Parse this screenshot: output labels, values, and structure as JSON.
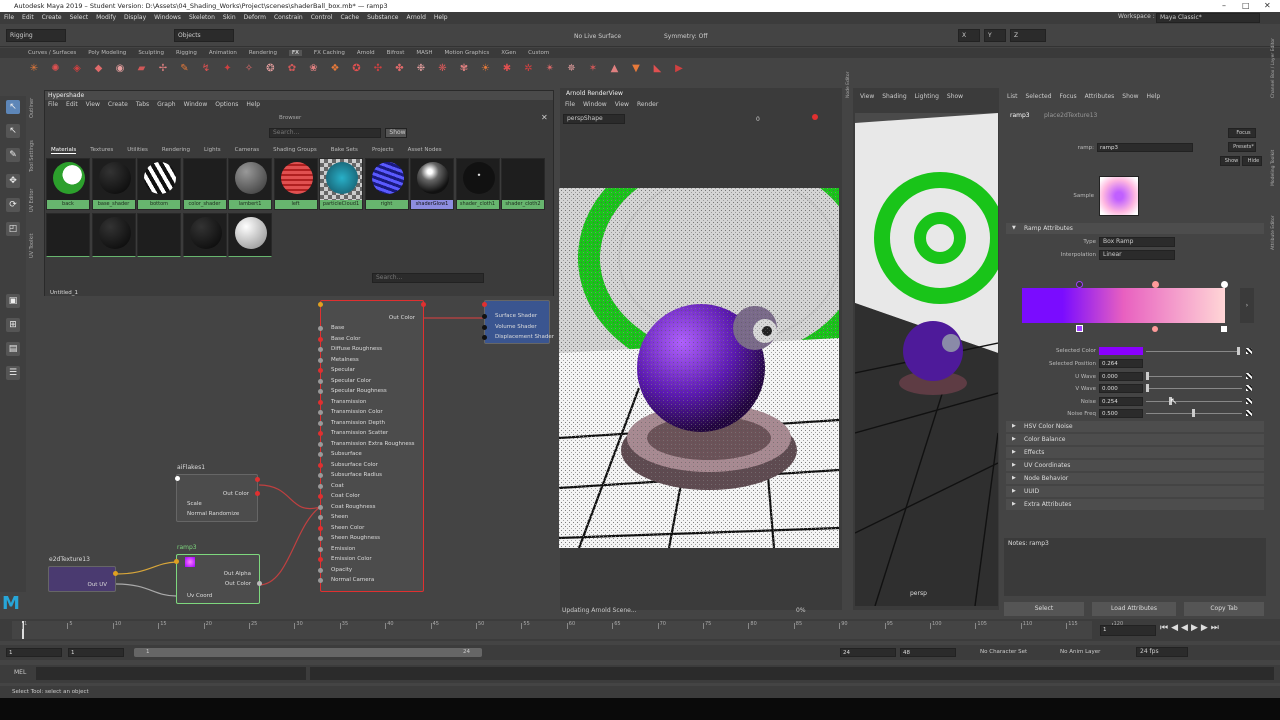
{
  "window": {
    "title": "Autodesk Maya 2019 – Student Version: D:\\Assets\\04_Shading_Works\\Project\\scenes\\shaderBall_box.mb*  —  ramp3"
  },
  "menubar": [
    "File",
    "Edit",
    "Create",
    "Select",
    "Modify",
    "Display",
    "Windows",
    "Skeleton",
    "Skin",
    "Deform",
    "Constrain",
    "Control",
    "Cache",
    "Substance",
    "Arnold",
    "Help"
  ],
  "workspace": {
    "label": "Workspace :",
    "value": "Maya Classic*"
  },
  "statusline": {
    "mode": "Rigging",
    "objects": "Objects",
    "live_surface": "No Live Surface",
    "symmetry": "Symmetry: Off",
    "x": "X",
    "y": "Y",
    "z": "Z"
  },
  "shelf_tabs": [
    "Curves / Surfaces",
    "Poly Modeling",
    "Sculpting",
    "Rigging",
    "Animation",
    "Rendering",
    "FX",
    "FX Caching",
    "Arnold",
    "Bifrost",
    "MASH",
    "Motion Graphics",
    "XGen",
    "Custom"
  ],
  "shelf_active": "FX",
  "side_labels": {
    "outliner": "Outliner",
    "tool_settings": "Tool Settings",
    "uv_editor": "UV Editor",
    "uv_toolkit": "UV Toolkit",
    "node_editor": "Node Editor",
    "channel_box": "Channel Box / Layer Editor",
    "modeling_toolkit": "Modeling Toolkit",
    "attribute_editor": "Attribute Editor"
  },
  "hypershade": {
    "title": "Hypershade",
    "menu": [
      "File",
      "Edit",
      "View",
      "Create",
      "Tabs",
      "Graph",
      "Window",
      "Options",
      "Help"
    ],
    "browser_label": "Browser",
    "search_placeholder": "Search...",
    "show_label": "Show",
    "tabs": [
      "Materials",
      "Textures",
      "Utilities",
      "Rendering",
      "Lights",
      "Cameras",
      "Shading Groups",
      "Bake Sets",
      "Projects",
      "Asset Nodes"
    ],
    "materials": [
      {
        "label": "back",
        "style": "green-white"
      },
      {
        "label": "base_shader",
        "style": "dark"
      },
      {
        "label": "bottom",
        "style": "stripes"
      },
      {
        "label": "color_shader",
        "style": "empty"
      },
      {
        "label": "lambert1",
        "style": "grey"
      },
      {
        "label": "left",
        "style": "red-stripes"
      },
      {
        "label": "particleCloud1",
        "style": "checker"
      },
      {
        "label": "right",
        "style": "blue-stripes"
      },
      {
        "label": "shaderGlow1",
        "style": "glossy",
        "selected": true
      },
      {
        "label": "shader_cloth1",
        "style": "dark-dot"
      },
      {
        "label": "shader_cloth2",
        "style": "empty"
      }
    ],
    "materials_row2": [
      "empty",
      "dark",
      "empty",
      "dark",
      "white"
    ],
    "graph_search": "Search...",
    "graph_tab": "Untitled_1",
    "nodes": {
      "aiflakes": {
        "name": "aiFlakes1",
        "out": "Out Color",
        "attrs": [
          "Scale",
          "Normal Randomize"
        ]
      },
      "place2d": {
        "name": "e2dTexture13",
        "out": "Out UV"
      },
      "ramp": {
        "name": "ramp3",
        "outs": [
          "Out Alpha",
          "Out Color"
        ],
        "in": "Uv Coord"
      },
      "standard": {
        "out": "Out Color",
        "attrs": [
          "Base",
          "Base Color",
          "Diffuse Roughness",
          "Metalness",
          "Specular",
          "Specular Color",
          "Specular Roughness",
          "Transmission",
          "Transmission Color",
          "Transmission Depth",
          "Transmission Scatter",
          "Transmission Extra Roughness",
          "Subsurface",
          "Subsurface Color",
          "Subsurface Radius",
          "Coat",
          "Coat Color",
          "Coat Roughness",
          "Sheen",
          "Sheen Color",
          "Sheen Roughness",
          "Emission",
          "Emission Color",
          "Opacity",
          "Normal Camera"
        ]
      },
      "sg": {
        "attrs": [
          "Surface Shader",
          "Volume Shader",
          "Displacement Shader"
        ]
      }
    }
  },
  "render_view": {
    "title": "Arnold RenderView",
    "menu": [
      "File",
      "Window",
      "View",
      "Render"
    ],
    "camera": "perspShape",
    "exposure": "0",
    "status": "Updating Arnold Scene...",
    "progress": "0%"
  },
  "viewport": {
    "menu": [
      "View",
      "Shading",
      "Lighting",
      "Show"
    ],
    "camera_label": "persp"
  },
  "attr_editor": {
    "menu": [
      "List",
      "Selected",
      "Focus",
      "Attributes",
      "Show",
      "Help"
    ],
    "tabs": [
      "ramp3",
      "place2dTexture13"
    ],
    "ramp_label": "ramp:",
    "ramp_value": "ramp3",
    "focus": "Focus",
    "presets": "Presets*",
    "show": "Show",
    "hide": "Hide",
    "sample_label": "Sample",
    "section_ramp": "Ramp Attributes",
    "type_label": "Type",
    "type_value": "Box Ramp",
    "interp_label": "Interpolation",
    "interp_value": "Linear",
    "selected_color_label": "Selected Color",
    "selected_position_label": "Selected Position",
    "selected_position_value": "0.264",
    "uwave_label": "U Wave",
    "uwave_value": "0.000",
    "vwave_label": "V Wave",
    "vwave_value": "0.000",
    "noise_label": "Noise",
    "noise_value": "0.254",
    "noisefreq_label": "Noise Freq",
    "noisefreq_value": "0.500",
    "sections": [
      "HSV Color Noise",
      "Color Balance",
      "Effects",
      "UV Coordinates",
      "Node Behavior",
      "UUID",
      "Extra Attributes"
    ],
    "notes": "Notes:  ramp3",
    "buttons": [
      "Select",
      "Load Attributes",
      "Copy Tab"
    ],
    "colors": {
      "ramp_left": "#7a0cff",
      "ramp_right": "#ffd6d6",
      "selected": "#8a00ff"
    }
  },
  "timeline": {
    "ticks": [
      "1",
      "5",
      "10",
      "15",
      "20",
      "25",
      "30",
      "35",
      "40",
      "45",
      "50",
      "55",
      "60",
      "65",
      "70",
      "75",
      "80",
      "85",
      "90",
      "95",
      "100",
      "105",
      "110",
      "115",
      "120"
    ],
    "current": "1"
  },
  "range": {
    "start": "1",
    "start2": "1",
    "inner_start": "1",
    "inner_end": "24",
    "end": "24",
    "end2": "48",
    "character": "No Character Set",
    "anim_layer": "No Anim Layer",
    "fps": "24 fps"
  },
  "command": {
    "lang": "MEL"
  },
  "help": "Select Tool: select an object"
}
